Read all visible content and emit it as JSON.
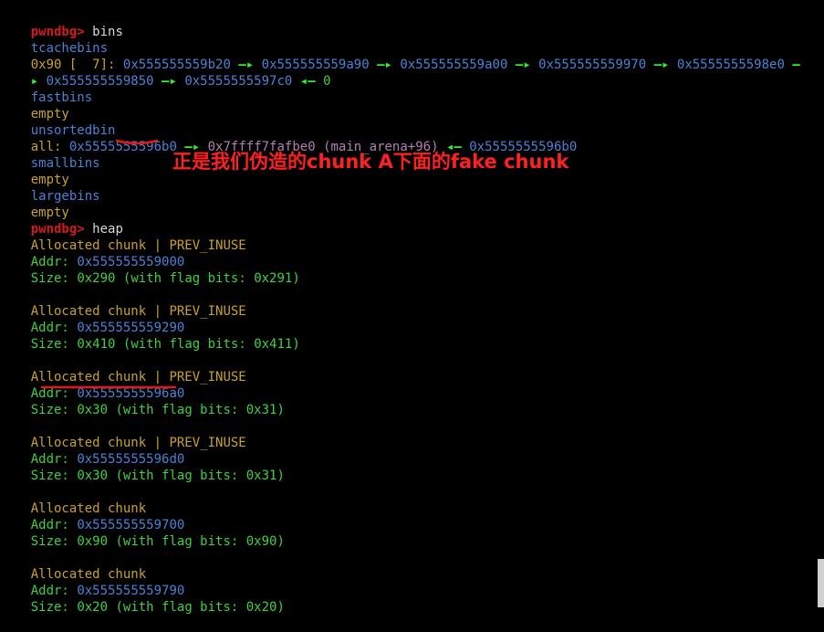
{
  "terminal": {
    "prompt": "pwndbg>",
    "commands": {
      "bins": "bins",
      "heap": "heap"
    },
    "tcachebins": {
      "header": "tcachebins",
      "entry_size": "0x90",
      "entry_count": "[  7]:",
      "chain_line1": [
        "0x555555559b20",
        "0x555555559a90",
        "0x555555559a00",
        "0x555555559970",
        "0x5555555598e0"
      ],
      "chain_line2": [
        "0x555555559850",
        "0x5555555597c0"
      ],
      "terminator": "0",
      "arrow": "—▸",
      "back_arrow": "◂—"
    },
    "fastbins": {
      "header": "fastbins",
      "status": "empty"
    },
    "unsortedbin": {
      "header": "unsortedbin",
      "label": "all:",
      "addr1": "0x5555555596b0",
      "addr2": "0x7ffff7fafbe0",
      "addr2_symbol": "(main_arena+96)",
      "addr3": "0x5555555596b0"
    },
    "smallbins": {
      "header": "smallbins",
      "status": "empty"
    },
    "largebins": {
      "header": "largebins",
      "status": "empty"
    },
    "chunks": [
      {
        "type": "Allocated chunk",
        "flags": "| PREV_INUSE",
        "addr_label": "Addr:",
        "addr": "0x555555559000",
        "size_label": "Size:",
        "size": "0x290",
        "flag_bits_text": "(with flag bits: 0x291)"
      },
      {
        "type": "Allocated chunk",
        "flags": "| PREV_INUSE",
        "addr_label": "Addr:",
        "addr": "0x555555559290",
        "size_label": "Size:",
        "size": "0x410",
        "flag_bits_text": "(with flag bits: 0x411)"
      },
      {
        "type": "Allocated chunk",
        "flags": "| PREV_INUSE",
        "addr_label": "Addr:",
        "addr": "0x5555555596a0",
        "size_label": "Size:",
        "size": "0x30",
        "flag_bits_text": "(with flag bits: 0x31)"
      },
      {
        "type": "Allocated chunk",
        "flags": "| PREV_INUSE",
        "addr_label": "Addr:",
        "addr": "0x5555555596d0",
        "size_label": "Size:",
        "size": "0x30",
        "flag_bits_text": "(with flag bits: 0x31)"
      },
      {
        "type": "Allocated chunk",
        "flags": "",
        "addr_label": "Addr:",
        "addr": "0x555555559700",
        "size_label": "Size:",
        "size": "0x90",
        "flag_bits_text": "(with flag bits: 0x90)"
      },
      {
        "type": "Allocated chunk",
        "flags": "",
        "addr_label": "Addr:",
        "addr": "0x555555559790",
        "size_label": "Size:",
        "size": "0x20",
        "flag_bits_text": "(with flag bits: 0x20)"
      }
    ]
  },
  "annotation": {
    "text": "正是我们伪造的chunk A下面的fake chunk",
    "color": "#ff2020"
  },
  "colors": {
    "background": "#000000",
    "prompt": "#d41a1a",
    "header": "#4a82d6",
    "address": "#4a82d6",
    "label": "#c9a227",
    "value": "#3fd13f",
    "arrow": "#2bf52b"
  }
}
